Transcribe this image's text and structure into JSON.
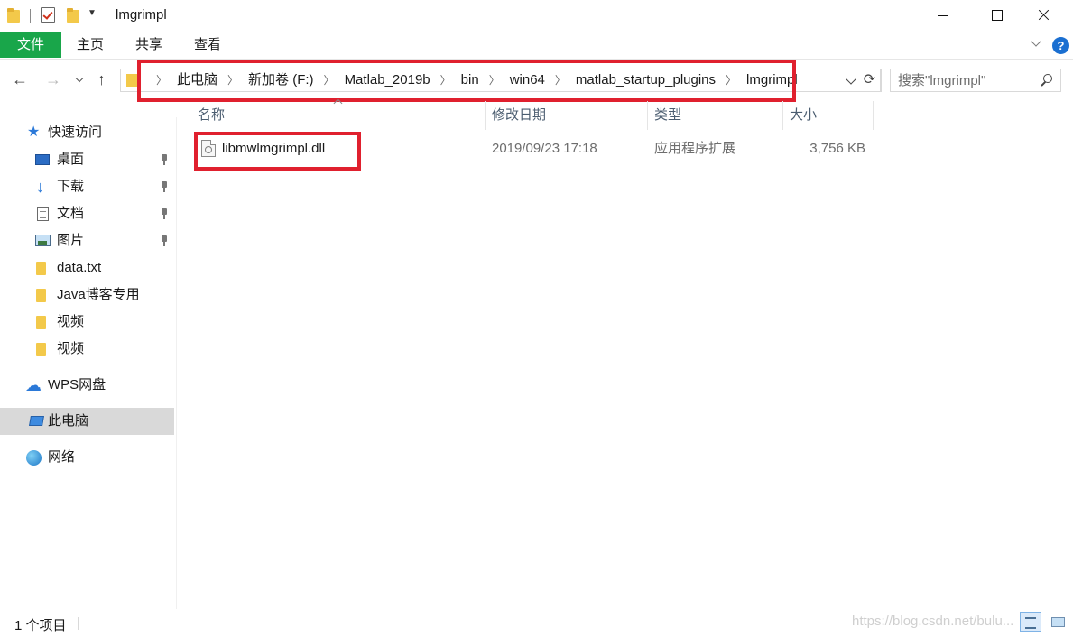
{
  "window": {
    "title": "lmgrimpl",
    "buttons": {
      "minimize": "minimize-icon",
      "maximize": "maximize-icon",
      "close": "close-icon"
    }
  },
  "quick_access_toolbar": {
    "icons": [
      "folder-icon",
      "properties-check-icon",
      "new-folder-icon",
      "customize-dropdown-icon"
    ]
  },
  "ribbon": {
    "file_tab": "文件",
    "tabs": [
      "主页",
      "共享",
      "查看"
    ],
    "accent": "#19a64a"
  },
  "navigation": {
    "back": "←",
    "forward": "→",
    "up": "↑",
    "breadcrumbs": [
      "此电脑",
      "新加卷 (F:)",
      "Matlab_2019b",
      "bin",
      "win64",
      "matlab_startup_plugins",
      "lmgrimpl"
    ],
    "search_placeholder": "搜索\"lmgrimpl\""
  },
  "sidebar": {
    "quick_access": "快速访问",
    "pinned": [
      {
        "label": "桌面",
        "icon": "desktop-icon"
      },
      {
        "label": "下载",
        "icon": "download-icon"
      },
      {
        "label": "文档",
        "icon": "documents-icon"
      },
      {
        "label": "图片",
        "icon": "pictures-icon"
      }
    ],
    "folders": [
      "data.txt",
      "Java博客专用",
      "视频",
      "视频"
    ],
    "wps_drive": "WPS网盘",
    "this_pc": "此电脑",
    "network": "网络"
  },
  "file_list": {
    "columns": [
      "名称",
      "修改日期",
      "类型",
      "大小"
    ],
    "rows": [
      {
        "name": "libmwlmgrimpl.dll",
        "modified": "2019/09/23 17:18",
        "type": "应用程序扩展",
        "size": "3,756 KB"
      }
    ]
  },
  "status_bar": {
    "item_count": "1 个项目",
    "watermark": "https://blog.csdn.net/bulu..."
  },
  "annotation_color": "#e0202e"
}
